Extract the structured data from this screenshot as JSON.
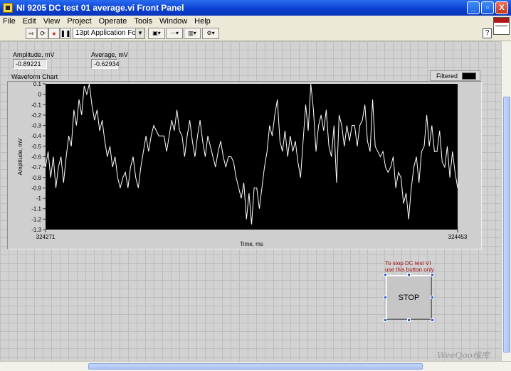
{
  "window": {
    "title": "NI 9205 DC test 01 average.vi Front Panel",
    "minimize": "_",
    "maximize": "▫",
    "close": "X"
  },
  "menu": [
    "File",
    "Edit",
    "View",
    "Project",
    "Operate",
    "Tools",
    "Window",
    "Help"
  ],
  "toolbar": {
    "font": "13pt Application Font",
    "help": "?"
  },
  "indicators": {
    "amplitude": {
      "label": "Amplitude, mV",
      "value": "-0.89221"
    },
    "average": {
      "label": "Average, mV",
      "value": "-0.62934"
    }
  },
  "chart": {
    "label": "Waveform Chart",
    "legend": "Filtered"
  },
  "stop": {
    "note_line1": "To stop DC test VI",
    "note_line2": "use this button only",
    "label": "STOP"
  },
  "watermark": "WeeQoo维库",
  "chart_data": {
    "type": "line",
    "title": "",
    "xlabel": "Time, ms",
    "ylabel": "Amplitude, mV",
    "x_range": [
      324271,
      324453
    ],
    "x_tick_labels": [
      "324271",
      "324453"
    ],
    "ylim": [
      -1.3,
      0.1
    ],
    "y_ticks": [
      0.1,
      0,
      -0.1,
      -0.2,
      -0.3,
      -0.4,
      -0.5,
      -0.6,
      -0.7,
      -0.8,
      -0.9,
      -1,
      -1.1,
      -1.2,
      -1.3
    ],
    "grid": false,
    "series": [
      {
        "name": "Filtered",
        "color": "#ffffff",
        "values": [
          -0.7,
          -0.55,
          -0.8,
          -0.6,
          -0.9,
          -0.7,
          -0.6,
          -0.85,
          -0.6,
          -0.4,
          -0.5,
          -0.15,
          -0.3,
          -0.05,
          -0.2,
          0.08,
          0,
          0.1,
          -0.1,
          -0.25,
          -0.15,
          -0.35,
          -0.25,
          -0.45,
          -0.6,
          -0.5,
          -0.7,
          -0.6,
          -0.8,
          -0.9,
          -0.8,
          -0.75,
          -0.9,
          -0.7,
          -0.6,
          -0.8,
          -0.9,
          -0.7,
          -0.55,
          -0.4,
          -0.55,
          -0.4,
          -0.3,
          -0.35,
          -0.4,
          -0.4,
          -0.4,
          -0.55,
          -0.4,
          -0.25,
          -0.35,
          -0.15,
          -0.35,
          -0.4,
          -0.6,
          -0.4,
          -0.25,
          -0.45,
          -0.6,
          -0.4,
          -0.25,
          -0.45,
          -0.6,
          -0.4,
          -0.5,
          -0.6,
          -0.7,
          -0.55,
          -0.45,
          -0.6,
          -0.7,
          -0.6,
          -0.6,
          -0.65,
          -0.8,
          -0.9,
          -1.0,
          -0.85,
          -1.2,
          -0.95,
          -1.25,
          -0.9,
          -0.9,
          -1.1,
          -0.9,
          -0.7,
          -0.55,
          -0.3,
          -0.4,
          -0.2,
          -0.05,
          -0.45,
          -0.55,
          -0.35,
          -0.6,
          -0.4,
          -0.55,
          -0.45,
          -0.65,
          -0.8,
          -0.45,
          -0.1,
          -0.35,
          0.1,
          -0.15,
          -0.55,
          -0.3,
          -0.2,
          -0.35,
          -0.15,
          -0.5,
          -0.6,
          -0.3,
          -0.85,
          -0.2,
          -0.3,
          -0.5,
          -0.3,
          -0.45,
          -0.3,
          -0.3,
          -0.5,
          -0.3,
          -0.25,
          -0.1,
          -0.45,
          -0.55,
          -0.05,
          -0.5,
          -0.55,
          -0.6,
          -0.55,
          -0.7,
          -0.75,
          -0.7,
          -0.6,
          -0.9,
          -0.75,
          -0.8,
          -1.05,
          -0.95,
          -1.2,
          -0.9,
          -0.7,
          -0.6,
          -0.85,
          -0.55,
          -0.5,
          -0.2,
          -0.5,
          -0.3,
          -0.55,
          -0.55,
          -0.35,
          -0.65,
          -0.7,
          -0.5,
          -0.8,
          -0.55,
          -0.75,
          -0.9
        ]
      }
    ]
  }
}
